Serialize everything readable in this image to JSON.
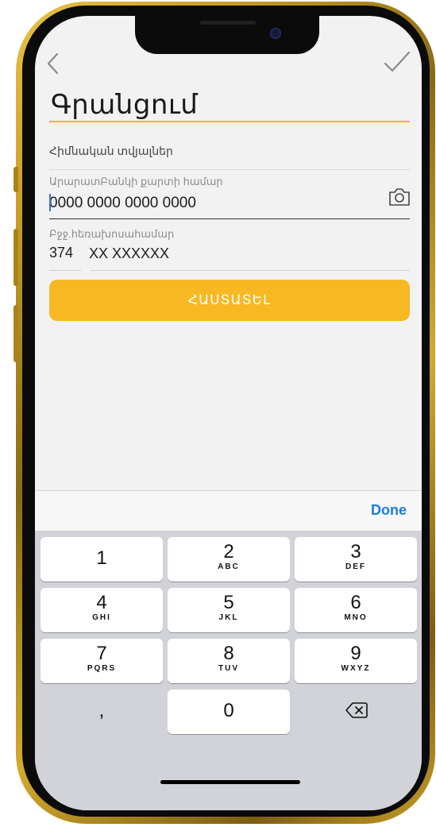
{
  "header": {
    "title": "Գրանցում"
  },
  "form": {
    "section_label": "Հիմնական տվյալներ",
    "card_caption": "ԱրարատԲանկի քարտի համար",
    "card_value": "0000 0000 0000 0000",
    "phone_caption": "Բջջ.հեռախոսահամար",
    "phone_code": "374",
    "phone_value": "XX XXXXXX",
    "confirm_label": "ՀԱՍՏԱՏԵԼ"
  },
  "keyboard": {
    "done_label": "Done",
    "keys": [
      {
        "num": "1",
        "letters": ""
      },
      {
        "num": "2",
        "letters": "ABC"
      },
      {
        "num": "3",
        "letters": "DEF"
      },
      {
        "num": "4",
        "letters": "GHI"
      },
      {
        "num": "5",
        "letters": "JKL"
      },
      {
        "num": "6",
        "letters": "MNO"
      },
      {
        "num": "7",
        "letters": "PQRS"
      },
      {
        "num": "8",
        "letters": "TUV"
      },
      {
        "num": "9",
        "letters": "WXYZ"
      },
      {
        "num": ",",
        "letters": ""
      },
      {
        "num": "0",
        "letters": ""
      }
    ]
  },
  "colors": {
    "accent": "#f8b823",
    "link": "#1b7de2",
    "frame_gold": "#c69d22"
  },
  "icons": {
    "back": "chevron-left-icon",
    "confirm": "checkmark-icon",
    "scan": "camera-icon",
    "delete": "backspace-icon"
  }
}
